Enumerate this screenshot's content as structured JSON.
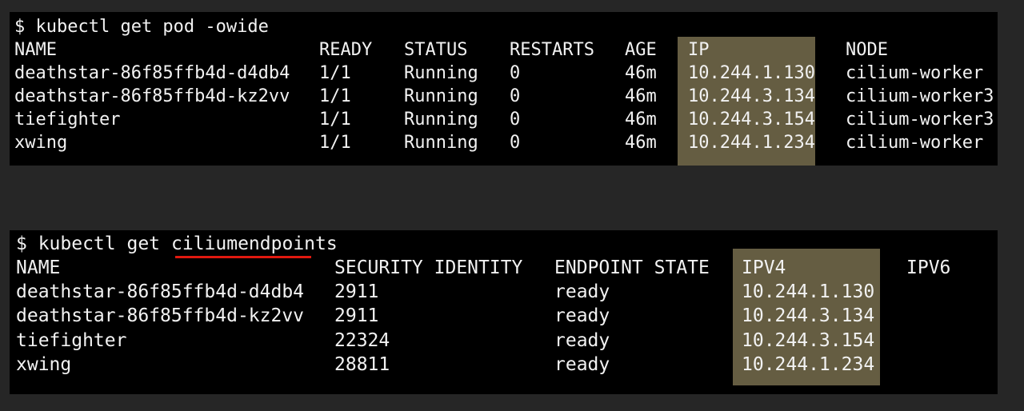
{
  "accent_colors": {
    "terminal_bg": "#000000",
    "page_bg": "#262626",
    "highlight": "#655d42",
    "underline": "#e0190f",
    "text": "#f2f2f2"
  },
  "terminal1": {
    "command": "$ kubectl get pod -owide",
    "headers": [
      "NAME",
      "READY",
      "STATUS",
      "RESTARTS",
      "AGE",
      "IP",
      "NODE"
    ],
    "rows": [
      [
        "deathstar-86f85ffb4d-d4db4",
        "1/1",
        "Running",
        "0",
        "46m",
        "10.244.1.130",
        "cilium-worker"
      ],
      [
        "deathstar-86f85ffb4d-kz2vv",
        "1/1",
        "Running",
        "0",
        "46m",
        "10.244.3.134",
        "cilium-worker3"
      ],
      [
        "tiefighter",
        "1/1",
        "Running",
        "0",
        "46m",
        "10.244.3.154",
        "cilium-worker3"
      ],
      [
        "xwing",
        "1/1",
        "Running",
        "0",
        "46m",
        "10.244.1.234",
        "cilium-worker"
      ]
    ]
  },
  "terminal2": {
    "command_prefix": "$ kubectl get ",
    "command_resource": "ciliumendpoints",
    "headers": [
      "NAME",
      "SECURITY IDENTITY",
      "ENDPOINT STATE",
      "IPV4",
      "IPV6"
    ],
    "rows": [
      [
        "deathstar-86f85ffb4d-d4db4",
        "2911",
        "ready",
        "10.244.1.130",
        ""
      ],
      [
        "deathstar-86f85ffb4d-kz2vv",
        "2911",
        "ready",
        "10.244.3.134",
        ""
      ],
      [
        "tiefighter",
        "22324",
        "ready",
        "10.244.3.154",
        ""
      ],
      [
        "xwing",
        "28811",
        "ready",
        "10.244.1.234",
        ""
      ]
    ]
  }
}
